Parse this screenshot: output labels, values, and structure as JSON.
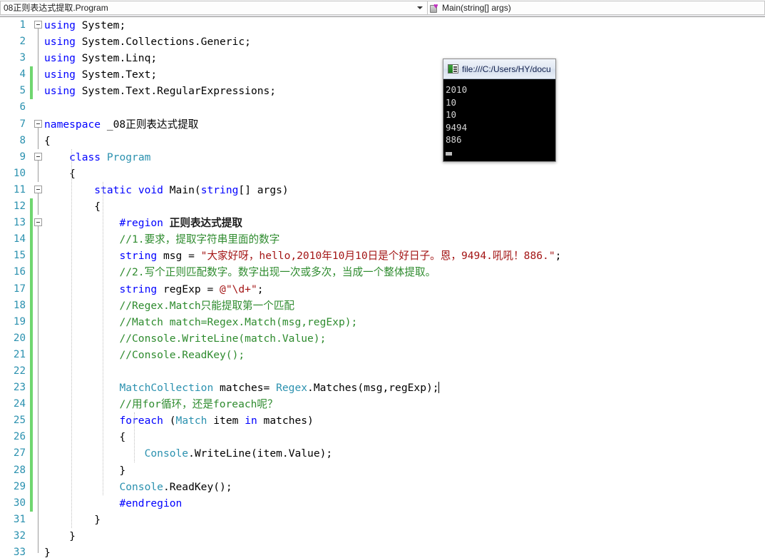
{
  "navbar": {
    "type_combo": {
      "value": "08正则表达式提取.Program",
      "dropdown_icon": "chevron-down-icon"
    },
    "member_combo": {
      "value": "Main(string[] args)",
      "icon": "method-private-icon",
      "dropdown_icon": "chevron-down-icon"
    }
  },
  "editor": {
    "lines": [
      {
        "n": "1",
        "changed": false,
        "fold": "box",
        "indent": 0,
        "tokens": [
          {
            "t": "using",
            "c": "kw"
          },
          {
            "t": " System;",
            "c": "plain"
          }
        ]
      },
      {
        "n": "2",
        "changed": false,
        "fold": "line",
        "indent": 0,
        "tokens": [
          {
            "t": "using",
            "c": "kw"
          },
          {
            "t": " System.Collections.Generic;",
            "c": "plain"
          }
        ]
      },
      {
        "n": "3",
        "changed": false,
        "fold": "line",
        "indent": 0,
        "tokens": [
          {
            "t": "using",
            "c": "kw"
          },
          {
            "t": " System.Linq;",
            "c": "plain"
          }
        ]
      },
      {
        "n": "4",
        "changed": true,
        "fold": "line",
        "indent": 0,
        "tokens": [
          {
            "t": "using",
            "c": "kw"
          },
          {
            "t": " System.Text;",
            "c": "plain"
          }
        ]
      },
      {
        "n": "5",
        "changed": true,
        "fold": "end",
        "indent": 0,
        "tokens": [
          {
            "t": "using",
            "c": "kw"
          },
          {
            "t": " System.Text.RegularExpressions;",
            "c": "plain"
          }
        ]
      },
      {
        "n": "6",
        "changed": false,
        "fold": "none",
        "indent": 0,
        "tokens": []
      },
      {
        "n": "7",
        "changed": false,
        "fold": "box",
        "indent": 0,
        "tokens": [
          {
            "t": "namespace",
            "c": "kw"
          },
          {
            "t": " _08正则表达式提取",
            "c": "plain"
          }
        ]
      },
      {
        "n": "8",
        "changed": false,
        "fold": "line",
        "indent": 0,
        "tokens": [
          {
            "t": "{",
            "c": "plain"
          }
        ]
      },
      {
        "n": "9",
        "changed": false,
        "fold": "box",
        "indent": 1,
        "tokens": [
          {
            "t": "    ",
            "c": "plain"
          },
          {
            "t": "class",
            "c": "kw"
          },
          {
            "t": " ",
            "c": "plain"
          },
          {
            "t": "Program",
            "c": "type"
          }
        ]
      },
      {
        "n": "10",
        "changed": false,
        "fold": "line",
        "indent": 1,
        "tokens": [
          {
            "t": "    {",
            "c": "plain"
          }
        ]
      },
      {
        "n": "11",
        "changed": false,
        "fold": "box",
        "indent": 2,
        "tokens": [
          {
            "t": "        ",
            "c": "plain"
          },
          {
            "t": "static",
            "c": "kw"
          },
          {
            "t": " ",
            "c": "plain"
          },
          {
            "t": "void",
            "c": "kw"
          },
          {
            "t": " Main(",
            "c": "plain"
          },
          {
            "t": "string",
            "c": "kw"
          },
          {
            "t": "[] args)",
            "c": "plain"
          }
        ]
      },
      {
        "n": "12",
        "changed": true,
        "fold": "line",
        "indent": 2,
        "tokens": [
          {
            "t": "        {",
            "c": "plain"
          }
        ]
      },
      {
        "n": "13",
        "changed": true,
        "fold": "box",
        "indent": 3,
        "tokens": [
          {
            "t": "            ",
            "c": "plain"
          },
          {
            "t": "#region",
            "c": "pre"
          },
          {
            "t": " ",
            "c": "plain"
          },
          {
            "t": "正则表达式提取",
            "c": "regiontext"
          }
        ]
      },
      {
        "n": "14",
        "changed": true,
        "fold": "line",
        "indent": 3,
        "tokens": [
          {
            "t": "            ",
            "c": "plain"
          },
          {
            "t": "//1.要求，提取字符串里面的数字",
            "c": "cmt"
          }
        ]
      },
      {
        "n": "15",
        "changed": true,
        "fold": "line",
        "indent": 3,
        "tokens": [
          {
            "t": "            ",
            "c": "plain"
          },
          {
            "t": "string",
            "c": "kw"
          },
          {
            "t": " msg = ",
            "c": "plain"
          },
          {
            "t": "\"大家好呀，hello,2010年10月10日是个好日子。恩，9494.吼吼！886.\"",
            "c": "str"
          },
          {
            "t": ";",
            "c": "plain"
          }
        ]
      },
      {
        "n": "16",
        "changed": true,
        "fold": "line",
        "indent": 3,
        "tokens": [
          {
            "t": "            ",
            "c": "plain"
          },
          {
            "t": "//2.写个正则匹配数字。数字出现一次或多次，当成一个整体提取。",
            "c": "cmt"
          }
        ]
      },
      {
        "n": "17",
        "changed": true,
        "fold": "line",
        "indent": 3,
        "tokens": [
          {
            "t": "            ",
            "c": "plain"
          },
          {
            "t": "string",
            "c": "kw"
          },
          {
            "t": " regExp = ",
            "c": "plain"
          },
          {
            "t": "@\"\\d+\"",
            "c": "str"
          },
          {
            "t": ";",
            "c": "plain"
          }
        ]
      },
      {
        "n": "18",
        "changed": true,
        "fold": "line",
        "indent": 3,
        "tokens": [
          {
            "t": "            ",
            "c": "plain"
          },
          {
            "t": "//Regex.Match只能提取第一个匹配",
            "c": "cmt"
          }
        ]
      },
      {
        "n": "19",
        "changed": true,
        "fold": "line",
        "indent": 3,
        "tokens": [
          {
            "t": "            ",
            "c": "plain"
          },
          {
            "t": "//Match match=Regex.Match(msg,regExp);",
            "c": "cmt"
          }
        ]
      },
      {
        "n": "20",
        "changed": true,
        "fold": "line",
        "indent": 3,
        "tokens": [
          {
            "t": "            ",
            "c": "plain"
          },
          {
            "t": "//Console.WriteLine(match.Value);",
            "c": "cmt"
          }
        ]
      },
      {
        "n": "21",
        "changed": true,
        "fold": "line",
        "indent": 3,
        "tokens": [
          {
            "t": "            ",
            "c": "plain"
          },
          {
            "t": "//Console.ReadKey();",
            "c": "cmt"
          }
        ]
      },
      {
        "n": "22",
        "changed": true,
        "fold": "line",
        "indent": 3,
        "tokens": []
      },
      {
        "n": "23",
        "changed": true,
        "fold": "line",
        "indent": 3,
        "tokens": [
          {
            "t": "            ",
            "c": "plain"
          },
          {
            "t": "MatchCollection",
            "c": "type"
          },
          {
            "t": " matches= ",
            "c": "plain"
          },
          {
            "t": "Regex",
            "c": "type"
          },
          {
            "t": ".Matches(msg,regExp);",
            "c": "plain"
          }
        ],
        "caret": true
      },
      {
        "n": "24",
        "changed": true,
        "fold": "line",
        "indent": 3,
        "tokens": [
          {
            "t": "            ",
            "c": "plain"
          },
          {
            "t": "//用for循环，还是foreach呢？",
            "c": "cmt"
          }
        ]
      },
      {
        "n": "25",
        "changed": true,
        "fold": "line",
        "indent": 3,
        "tokens": [
          {
            "t": "            ",
            "c": "plain"
          },
          {
            "t": "foreach",
            "c": "kw"
          },
          {
            "t": " (",
            "c": "plain"
          },
          {
            "t": "Match",
            "c": "type"
          },
          {
            "t": " item ",
            "c": "plain"
          },
          {
            "t": "in",
            "c": "kw"
          },
          {
            "t": " matches)",
            "c": "plain"
          }
        ]
      },
      {
        "n": "26",
        "changed": true,
        "fold": "line",
        "indent": 3,
        "tokens": [
          {
            "t": "            {",
            "c": "plain"
          }
        ]
      },
      {
        "n": "27",
        "changed": true,
        "fold": "line",
        "indent": 4,
        "tokens": [
          {
            "t": "                ",
            "c": "plain"
          },
          {
            "t": "Console",
            "c": "type"
          },
          {
            "t": ".WriteLine(item.Value);",
            "c": "plain"
          }
        ]
      },
      {
        "n": "28",
        "changed": true,
        "fold": "line",
        "indent": 3,
        "tokens": [
          {
            "t": "            }",
            "c": "plain"
          }
        ]
      },
      {
        "n": "29",
        "changed": true,
        "fold": "line",
        "indent": 3,
        "tokens": [
          {
            "t": "            ",
            "c": "plain"
          },
          {
            "t": "Console",
            "c": "type"
          },
          {
            "t": ".ReadKey();",
            "c": "plain"
          }
        ]
      },
      {
        "n": "30",
        "changed": true,
        "fold": "line",
        "indent": 3,
        "tokens": [
          {
            "t": "            ",
            "c": "plain"
          },
          {
            "t": "#endregion",
            "c": "pre"
          }
        ]
      },
      {
        "n": "31",
        "changed": false,
        "fold": "line",
        "indent": 2,
        "tokens": [
          {
            "t": "        }",
            "c": "plain"
          }
        ]
      },
      {
        "n": "32",
        "changed": false,
        "fold": "line",
        "indent": 1,
        "tokens": [
          {
            "t": "    }",
            "c": "plain"
          }
        ]
      },
      {
        "n": "33",
        "changed": false,
        "fold": "endline",
        "indent": 0,
        "tokens": [
          {
            "t": "}",
            "c": "plain"
          }
        ]
      }
    ]
  },
  "console": {
    "title": "file:///C:/Users/HY/docu",
    "icon": "console-app-icon",
    "output": [
      "2010",
      "10",
      "10",
      "9494",
      "886"
    ]
  },
  "colors": {
    "keyword": "#0000FF",
    "type": "#2B91AF",
    "string": "#A31515",
    "comment": "#2E8B2E",
    "line_number": "#2B91AF",
    "change_bar": "#6FD66F",
    "editor_background": "#FFFFFF",
    "console_background": "#000000"
  }
}
